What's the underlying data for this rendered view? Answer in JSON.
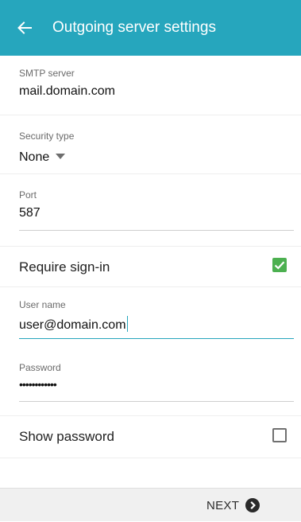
{
  "theme": {
    "accent": "#26a6bd",
    "checkbox_checked": "#4cb050"
  },
  "header": {
    "back_icon": "arrow-left-icon",
    "title": "Outgoing server settings"
  },
  "form": {
    "smtp_server": {
      "label": "SMTP server",
      "value": "mail.domain.com"
    },
    "security_type": {
      "label": "Security type",
      "value": "None",
      "icon": "dropdown-triangle-icon"
    },
    "port": {
      "label": "Port",
      "value": "587"
    },
    "require_signin": {
      "label": "Require sign-in",
      "checked": true
    },
    "username": {
      "label": "User name",
      "value": "user@domain.com",
      "focused": true
    },
    "password": {
      "label": "Password",
      "value": "••••••••••••"
    },
    "show_password": {
      "label": "Show password",
      "checked": false
    }
  },
  "footer": {
    "next_label": "NEXT",
    "next_icon": "chevron-right-circle-icon"
  }
}
